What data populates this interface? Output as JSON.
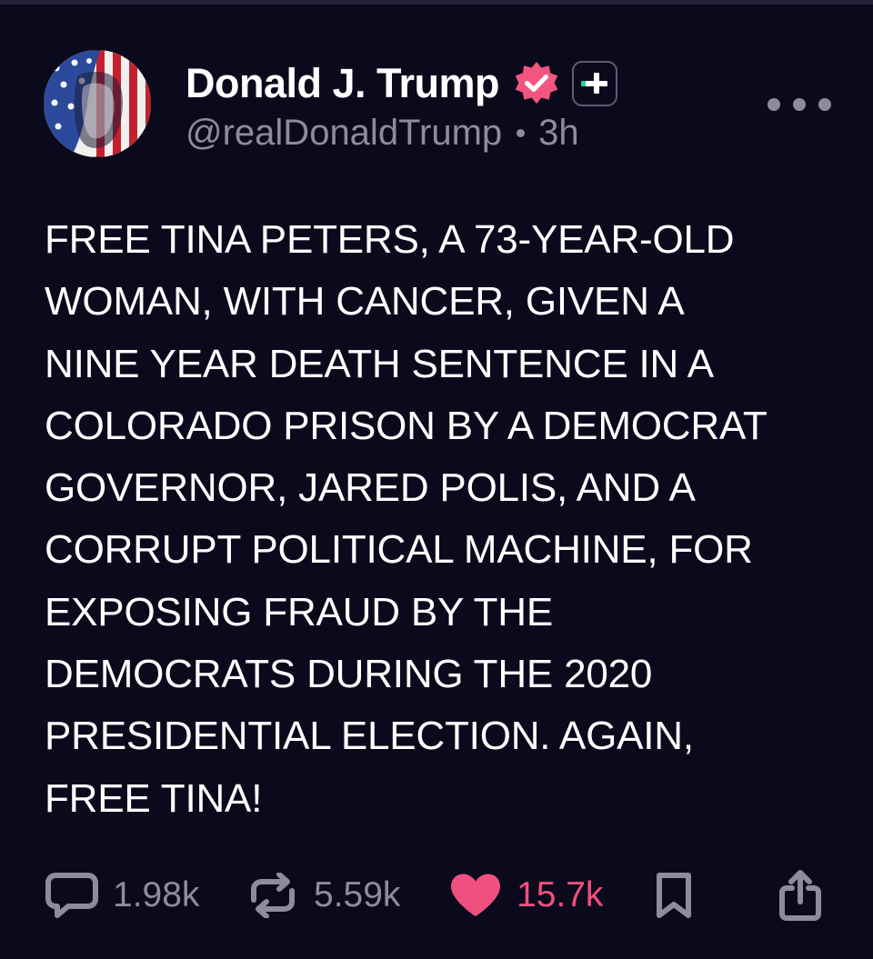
{
  "author": {
    "display_name": "Donald J. Trump",
    "handle": "@realDonaldTrump",
    "time_ago": "3h",
    "verified_badge_color": "#f2557f",
    "plus_badge_accent": "#1ed6a0"
  },
  "post": {
    "text": "FREE TINA PETERS, A 73-YEAR-OLD\nWOMAN, WITH CANCER, GIVEN A\nNINE YEAR DEATH SENTENCE IN A\nCOLORADO PRISON BY A DEMOCRAT\nGOVERNOR, JARED POLIS, AND A\nCORRUPT POLITICAL MACHINE, FOR\nEXPOSING FRAUD BY THE\nDEMOCRATS DURING THE 2020\nPRESIDENTIAL ELECTION. AGAIN,\nFREE TINA!"
  },
  "actions": {
    "replies": {
      "icon": "reply-icon",
      "count": "1.98k"
    },
    "reposts": {
      "icon": "repost-icon",
      "count": "5.59k"
    },
    "likes": {
      "icon": "heart-icon",
      "count": "15.7k",
      "liked": true,
      "color": "#f0507f"
    },
    "bookmark": {
      "icon": "bookmark-icon"
    },
    "share": {
      "icon": "share-icon"
    }
  },
  "menu": {
    "icon": "more-options-icon"
  },
  "colors": {
    "background": "#0b0a1d",
    "text_primary": "#ffffff",
    "text_secondary": "#8d8c9e"
  }
}
